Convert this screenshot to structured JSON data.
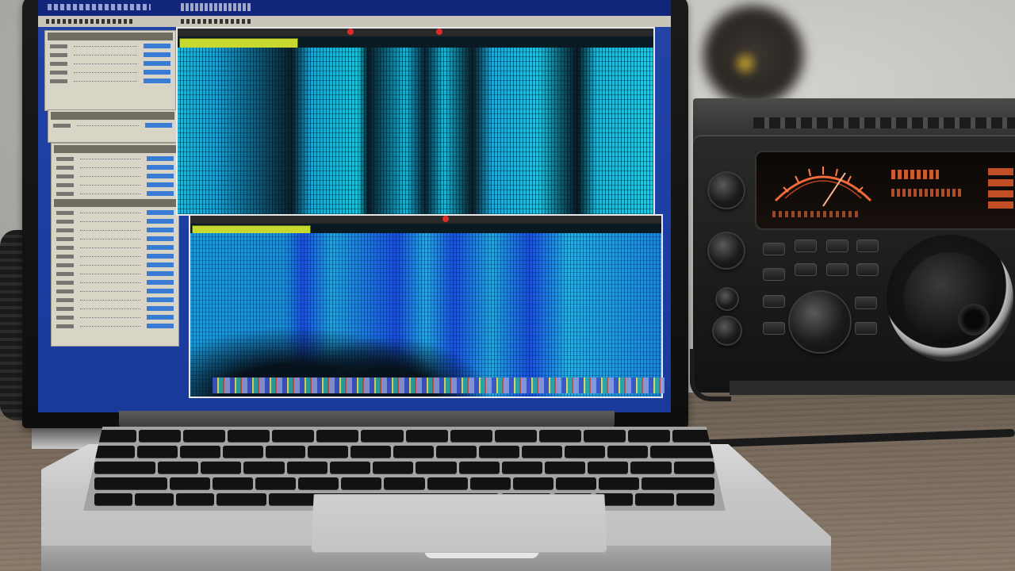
{
  "scene": "laptop-with-sdr-software-and-ham-radio",
  "colors": {
    "waterfall_cyan": "#1fb6d6",
    "waterfall_blue": "#1b4fd8",
    "radio_display_orange": "#f06a3a",
    "desktop_blue": "#1c3ea3"
  },
  "icons": {
    "marker": "red-dot-marker",
    "knob": "rotary-knob"
  },
  "screen": {
    "panels": [
      "side-panel-top",
      "side-panel-middle",
      "side-panel-bottom"
    ],
    "spectrum_views": [
      "waterfall-top",
      "waterfall-bottom"
    ]
  },
  "radio": {
    "buttons": 12,
    "knobs": 6
  }
}
